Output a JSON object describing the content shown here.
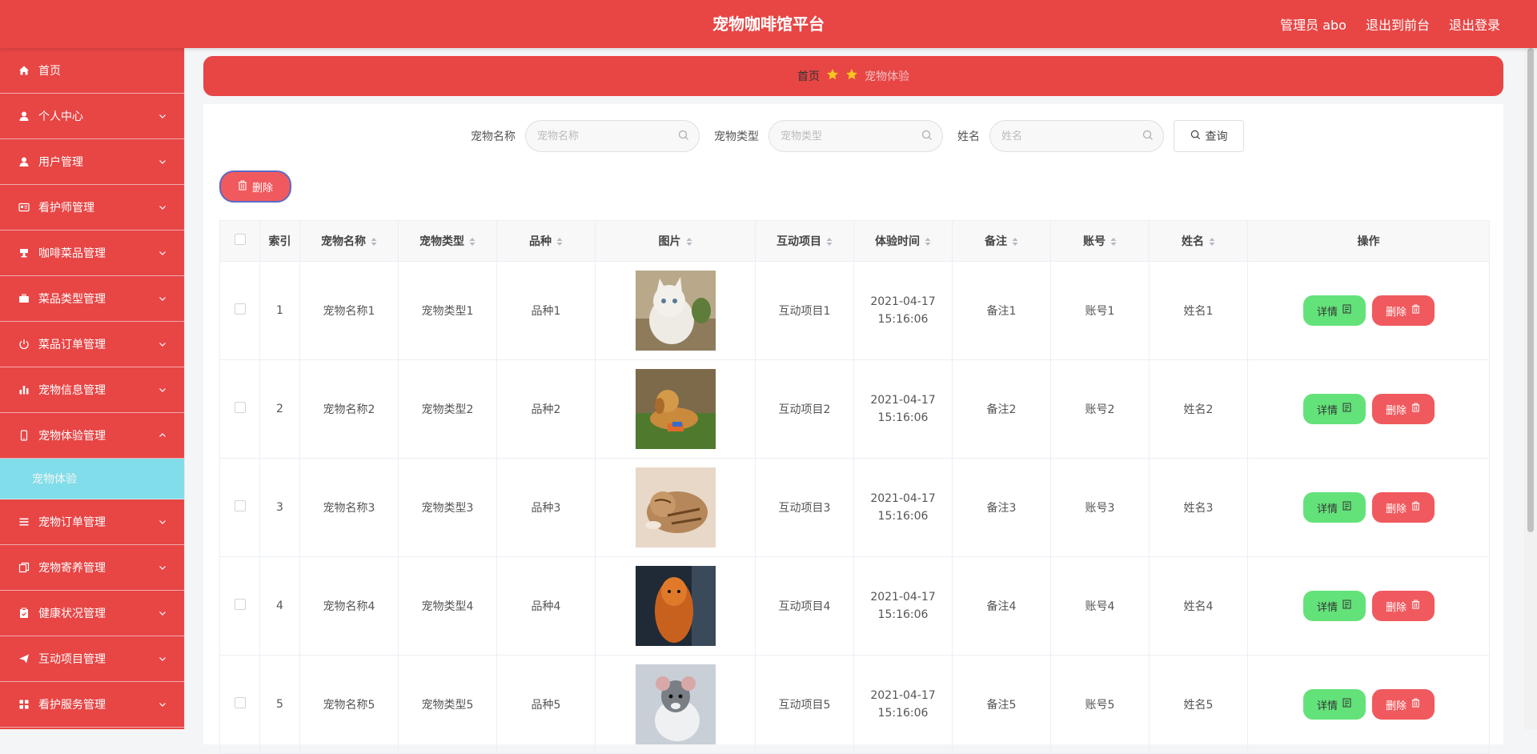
{
  "header": {
    "title": "宠物咖啡馆平台",
    "user": "管理员 abo",
    "to_front": "退出到前台",
    "logout": "退出登录"
  },
  "sidebar": {
    "items": [
      {
        "label": "首页",
        "icon": "home-icon"
      },
      {
        "label": "个人中心",
        "icon": "user-icon"
      },
      {
        "label": "用户管理",
        "icon": "user-icon"
      },
      {
        "label": "看护师管理",
        "icon": "id-card-icon"
      },
      {
        "label": "咖啡菜品管理",
        "icon": "cup-icon"
      },
      {
        "label": "菜品类型管理",
        "icon": "briefcase-icon"
      },
      {
        "label": "菜品订单管理",
        "icon": "power-icon"
      },
      {
        "label": "宠物信息管理",
        "icon": "bar-chart-icon"
      },
      {
        "label": "宠物体验管理",
        "icon": "mobile-icon"
      },
      {
        "label": "宠物订单管理",
        "icon": "list-icon"
      },
      {
        "label": "宠物寄养管理",
        "icon": "copy-icon"
      },
      {
        "label": "健康状况管理",
        "icon": "clipboard-icon"
      },
      {
        "label": "互动项目管理",
        "icon": "send-icon"
      },
      {
        "label": "看护服务管理",
        "icon": "grid-icon"
      }
    ],
    "active_sub": "宠物体验"
  },
  "breadcrumb": {
    "home": "首页",
    "current": "宠物体验"
  },
  "search": {
    "fields": [
      {
        "label": "宠物名称",
        "placeholder": "宠物名称"
      },
      {
        "label": "宠物类型",
        "placeholder": "宠物类型"
      },
      {
        "label": "姓名",
        "placeholder": "姓名"
      }
    ],
    "query_label": "查询"
  },
  "toolbar": {
    "delete_label": "删除"
  },
  "table": {
    "columns": [
      "索引",
      "宠物名称",
      "宠物类型",
      "品种",
      "图片",
      "互动项目",
      "体验时间",
      "备注",
      "账号",
      "姓名",
      "操作"
    ],
    "rows": [
      {
        "index": "1",
        "name": "宠物名称1",
        "type": "宠物类型1",
        "breed": "品种1",
        "image": "cat",
        "project": "互动项目1",
        "time": "2021-04-17 15:16:06",
        "note": "备注1",
        "account": "账号1",
        "person": "姓名1"
      },
      {
        "index": "2",
        "name": "宠物名称2",
        "type": "宠物类型2",
        "breed": "品种2",
        "image": "dog",
        "project": "互动项目2",
        "time": "2021-04-17 15:16:06",
        "note": "备注2",
        "account": "账号2",
        "person": "姓名2"
      },
      {
        "index": "3",
        "name": "宠物名称3",
        "type": "宠物类型3",
        "breed": "品种3",
        "image": "kitten",
        "project": "互动项目3",
        "time": "2021-04-17 15:16:06",
        "note": "备注3",
        "account": "账号3",
        "person": "姓名3"
      },
      {
        "index": "4",
        "name": "宠物名称4",
        "type": "宠物类型4",
        "breed": "品种4",
        "image": "dog",
        "project": "互动项目4",
        "time": "2021-04-17 15:16:06",
        "note": "备注4",
        "account": "账号4",
        "person": "姓名4"
      },
      {
        "index": "5",
        "name": "宠物名称5",
        "type": "宠物类型5",
        "breed": "品种5",
        "image": "rat",
        "project": "互动项目5",
        "time": "2021-04-17 15:16:06",
        "note": "备注5",
        "account": "账号5",
        "person": "姓名5"
      }
    ],
    "detail_label": "详情",
    "delete_label": "删除"
  },
  "colors": {
    "primary": "#e84545",
    "active_sub": "#80dde9",
    "detail_btn": "#63e27a",
    "delete_btn": "#f05a5e"
  }
}
